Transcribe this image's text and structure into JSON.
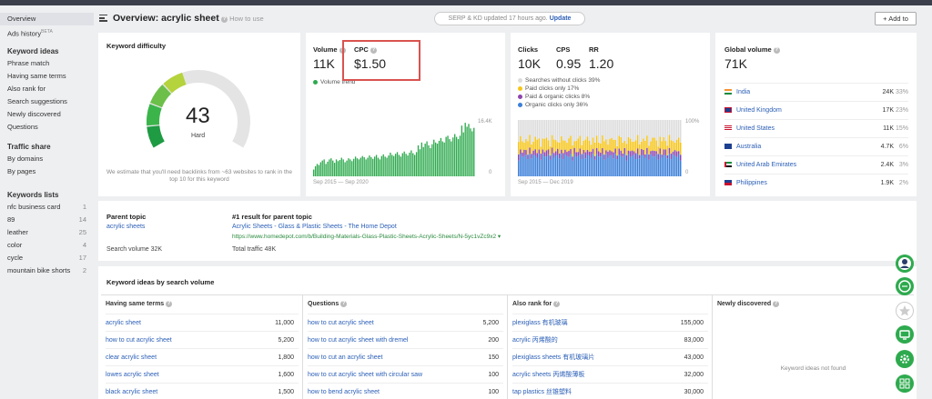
{
  "sidebar": {
    "nav": [
      {
        "label": "Overview",
        "active": true
      },
      {
        "label": "Ads history",
        "badge": "BETA"
      }
    ],
    "keyword_ideas": {
      "title": "Keyword ideas",
      "items": [
        "Phrase match",
        "Having same terms",
        "Also rank for",
        "Search suggestions",
        "Newly discovered",
        "Questions"
      ]
    },
    "traffic_share": {
      "title": "Traffic share",
      "items": [
        "By domains",
        "By pages"
      ]
    },
    "keyword_lists": {
      "title": "Keywords lists",
      "items": [
        {
          "name": "nfc business card",
          "count": "1"
        },
        {
          "name": "89",
          "count": "14"
        },
        {
          "name": "leather",
          "count": "25"
        },
        {
          "name": "color",
          "count": "4"
        },
        {
          "name": "cycle",
          "count": "17"
        },
        {
          "name": "mountain bike shorts",
          "count": "2"
        }
      ]
    }
  },
  "header": {
    "title": "Overview: acrylic sheet",
    "how_to": "How to use",
    "serp_status": "SERP & KD updated 17 hours ago.",
    "update_label": "Update",
    "add_to_label": "Add to"
  },
  "difficulty": {
    "title": "Keyword difficulty",
    "value": "43",
    "label": "Hard",
    "fraction": 0.43,
    "note": "We estimate that you'll need backlinks from ~63 websites to rank in the top 10 for this keyword"
  },
  "volume": {
    "title": "Volume",
    "value": "11K",
    "cpc_title": "CPC",
    "cpc_value": "$1.50",
    "legend": "Volume trend",
    "axis_top": "16.4K",
    "axis_bottom": "0",
    "range": "Sep 2015 — Sep 2020",
    "trend": [
      0.12,
      0.18,
      0.22,
      0.2,
      0.25,
      0.28,
      0.3,
      0.22,
      0.26,
      0.3,
      0.32,
      0.28,
      0.24,
      0.3,
      0.27,
      0.29,
      0.33,
      0.3,
      0.25,
      0.28,
      0.32,
      0.3,
      0.27,
      0.31,
      0.35,
      0.32,
      0.3,
      0.33,
      0.36,
      0.34,
      0.3,
      0.33,
      0.37,
      0.34,
      0.31,
      0.35,
      0.38,
      0.33,
      0.3,
      0.36,
      0.39,
      0.35,
      0.33,
      0.37,
      0.42,
      0.38,
      0.36,
      0.4,
      0.43,
      0.38,
      0.35,
      0.41,
      0.44,
      0.4,
      0.37,
      0.42,
      0.46,
      0.41,
      0.38,
      0.43,
      0.55,
      0.48,
      0.6,
      0.52,
      0.58,
      0.62,
      0.55,
      0.5,
      0.57,
      0.65,
      0.6,
      0.58,
      0.63,
      0.68,
      0.62,
      0.6,
      0.7,
      0.72,
      0.66,
      0.62,
      0.69,
      0.75,
      0.7,
      0.66,
      0.72,
      0.9,
      0.78,
      0.95,
      0.88,
      0.93,
      0.85,
      0.8,
      0.86
    ]
  },
  "clicks": {
    "title": "Clicks",
    "value": "10K",
    "cps_title": "CPS",
    "cps_value": "0.95",
    "rr_title": "RR",
    "rr_value": "1.20",
    "legend": [
      {
        "label": "Searches without clicks 39%",
        "color": "#dcdcdc"
      },
      {
        "label": "Paid clicks only 17%",
        "color": "#f5c518"
      },
      {
        "label": "Paid & organic clicks 8%",
        "color": "#8e44ad"
      },
      {
        "label": "Organic clicks only 36%",
        "color": "#3b7fd9"
      }
    ],
    "axis_top": "100%",
    "axis_bottom": "0",
    "range": "Sep 2015 — Dec 2019"
  },
  "global": {
    "title": "Global volume",
    "value": "71K",
    "countries": [
      {
        "name": "India",
        "volume": "24K",
        "pct": "33%"
      },
      {
        "name": "United Kingdom",
        "volume": "17K",
        "pct": "23%"
      },
      {
        "name": "United States",
        "volume": "11K",
        "pct": "15%"
      },
      {
        "name": "Australia",
        "volume": "4.7K",
        "pct": "6%"
      },
      {
        "name": "United Arab Emirates",
        "volume": "2.4K",
        "pct": "3%"
      },
      {
        "name": "Philippines",
        "volume": "1.9K",
        "pct": "2%"
      }
    ]
  },
  "parent": {
    "title": "Parent topic",
    "topic": "acrylic sheets",
    "search_volume": "Search volume 32K",
    "result_title": "#1 result for parent topic",
    "result_link": "Acrylic Sheets - Glass & Plastic Sheets - The Home Depot",
    "result_url": "https://www.homedepot.com/b/Building-Materials-Glass-Plastic-Sheets-Acrylic-Sheets/N-5yc1vZc9x2",
    "total_traffic": "Total traffic 48K"
  },
  "ideas": {
    "title": "Keyword ideas by search volume",
    "columns": [
      {
        "title": "Having same terms",
        "rows": [
          {
            "kw": "acrylic sheet",
            "v": "11,000"
          },
          {
            "kw": "how to cut acrylic sheet",
            "v": "5,200"
          },
          {
            "kw": "clear acrylic sheet",
            "v": "1,800"
          },
          {
            "kw": "lowes acrylic sheet",
            "v": "1,600"
          },
          {
            "kw": "black acrylic sheet",
            "v": "1,500"
          }
        ]
      },
      {
        "title": "Questions",
        "rows": [
          {
            "kw": "how to cut acrylic sheet",
            "v": "5,200"
          },
          {
            "kw": "how to cut acrylic sheet with dremel",
            "v": "200"
          },
          {
            "kw": "how to cut an acrylic sheet",
            "v": "150"
          },
          {
            "kw": "how to cut acrylic sheet with circular saw",
            "v": "100"
          },
          {
            "kw": "how to bend acrylic sheet",
            "v": "100"
          }
        ]
      },
      {
        "title": "Also rank for",
        "rows": [
          {
            "kw": "plexiglass 有机玻璃",
            "v": "155,000"
          },
          {
            "kw": "acrylic 丙烯酸的",
            "v": "83,000"
          },
          {
            "kw": "plexiglass sheets 有机玻璃片",
            "v": "43,000"
          },
          {
            "kw": "acrylic sheets 丙烯酸薄板",
            "v": "32,000"
          },
          {
            "kw": "tap plastics 丝锥塑料",
            "v": "30,000"
          }
        ]
      },
      {
        "title": "Newly discovered",
        "empty": "Keyword ideas not found"
      }
    ]
  }
}
